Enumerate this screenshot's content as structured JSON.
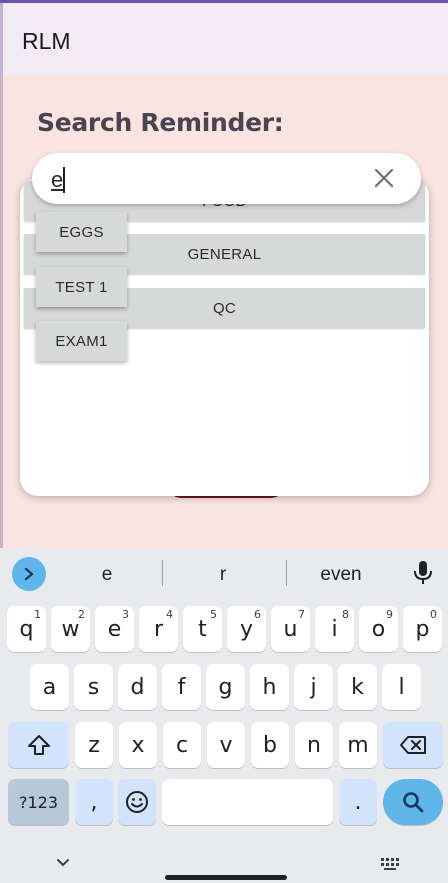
{
  "app": {
    "title": "RLM"
  },
  "screen": {
    "title": "Search Reminder:"
  },
  "search": {
    "value": "e"
  },
  "list_items": [
    "FOOD",
    "GENERAL",
    "QC"
  ],
  "suggestions": [
    "EGGS",
    "TEST 1",
    "EXAM1"
  ],
  "keyboard": {
    "suggestions": [
      "e",
      "r",
      "even"
    ],
    "row1": [
      {
        "key": "q",
        "hint": "1"
      },
      {
        "key": "w",
        "hint": "2"
      },
      {
        "key": "e",
        "hint": "3"
      },
      {
        "key": "r",
        "hint": "4"
      },
      {
        "key": "t",
        "hint": "5"
      },
      {
        "key": "y",
        "hint": "6"
      },
      {
        "key": "u",
        "hint": "7"
      },
      {
        "key": "i",
        "hint": "8"
      },
      {
        "key": "o",
        "hint": "9"
      },
      {
        "key": "p",
        "hint": "0"
      }
    ],
    "row2": [
      "a",
      "s",
      "d",
      "f",
      "g",
      "h",
      "j",
      "k",
      "l"
    ],
    "row3": [
      "z",
      "x",
      "c",
      "v",
      "b",
      "n",
      "m"
    ],
    "symbols_label": "?123",
    "comma_label": ",",
    "period_label": "."
  },
  "colors": {
    "background": "#f9e4e2",
    "app_bar": "#f2ebf5",
    "accent_blue": "#5fb6ea",
    "chip_gray": "#d7d8d8"
  }
}
